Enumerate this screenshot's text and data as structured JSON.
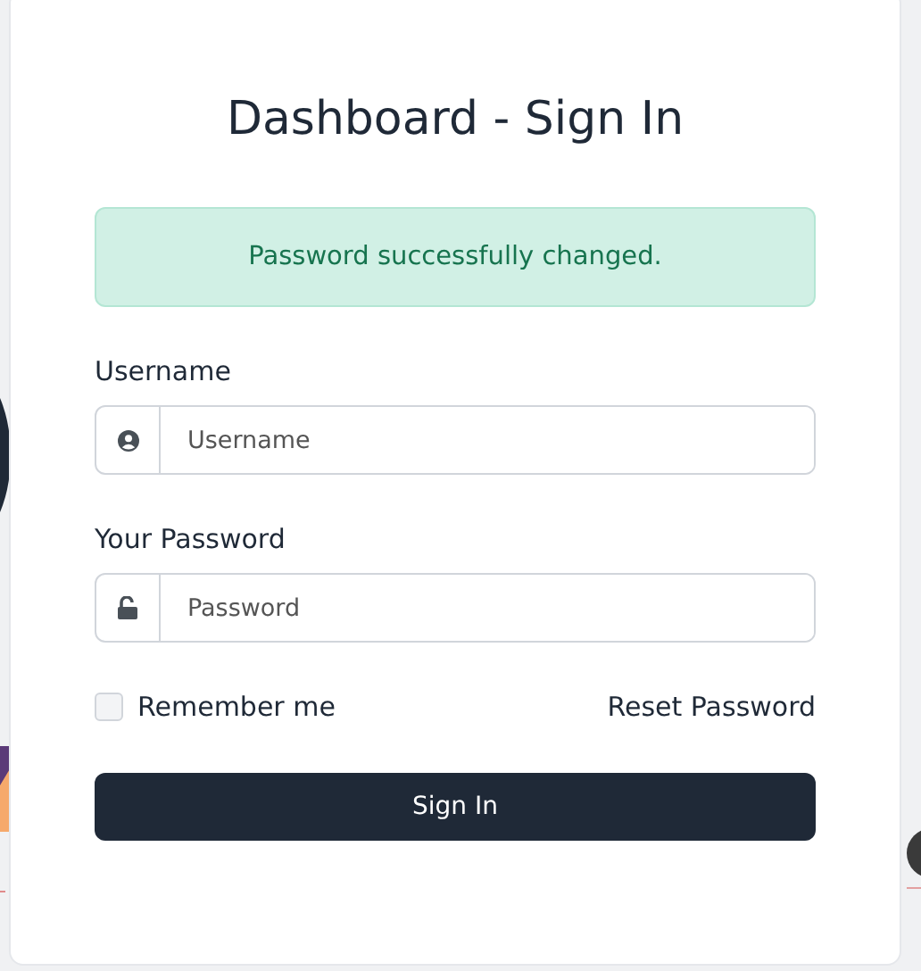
{
  "title": "Dashboard - Sign In",
  "alert": {
    "text": "Password successfully changed."
  },
  "username": {
    "label": "Username",
    "placeholder": "Username"
  },
  "password": {
    "label": "Your Password",
    "placeholder": "Password"
  },
  "remember": {
    "label": "Remember me",
    "checked": false
  },
  "reset_link": "Reset Password",
  "submit": "Sign In"
}
